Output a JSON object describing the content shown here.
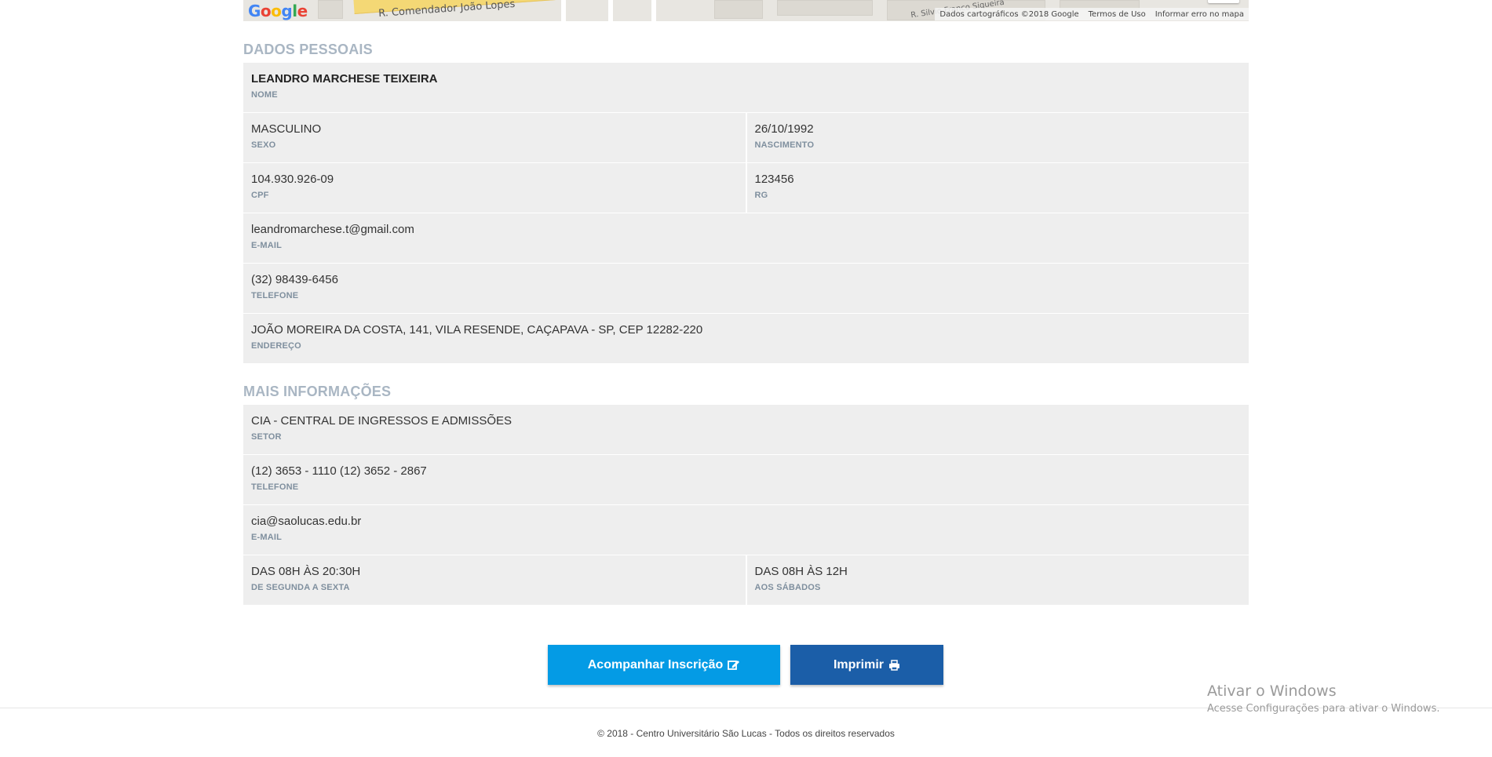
{
  "map": {
    "street_main": "R. Comendador João Lopes",
    "street_secondary": "R. Silvio Franco Siqueira",
    "logo_text": "Google",
    "attribution": {
      "data": "Dados cartográficos ©2018 Google",
      "terms": "Termos de Uso",
      "report": "Informar erro no mapa"
    }
  },
  "dados_pessoais": {
    "title": "DADOS PESSOAIS",
    "nome": {
      "value": "LEANDRO MARCHESE TEIXEIRA",
      "label": "NOME"
    },
    "sexo": {
      "value": "MASCULINO",
      "label": "SEXO"
    },
    "nascimento": {
      "value": "26/10/1992",
      "label": "NASCIMENTO"
    },
    "cpf": {
      "value": "104.930.926-09",
      "label": "CPF"
    },
    "rg": {
      "value": "123456",
      "label": "RG"
    },
    "email": {
      "value": "leandromarchese.t@gmail.com",
      "label": "E-MAIL"
    },
    "telefone": {
      "value": "(32) 98439-6456",
      "label": "TELEFONE"
    },
    "endereco": {
      "value": "JOÃO MOREIRA DA COSTA, 141, VILA RESENDE, CAÇAPAVA - SP, CEP 12282-220",
      "label": "ENDEREÇO"
    }
  },
  "mais_informacoes": {
    "title": "MAIS INFORMAÇÕES",
    "setor": {
      "value": "CIA - CENTRAL DE INGRESSOS E ADMISSÕES",
      "label": "SETOR"
    },
    "telefone": {
      "value": "(12) 3653 - 1110 (12) 3652 - 2867",
      "label": "TELEFONE"
    },
    "email": {
      "value": "cia@saolucas.edu.br",
      "label": "E-MAIL"
    },
    "semana": {
      "value": "DAS 08H ÀS 20:30H",
      "label": "DE SEGUNDA A SEXTA"
    },
    "sabado": {
      "value": "DAS 08H ÀS 12H",
      "label": "AOS SÁBADOS"
    }
  },
  "actions": {
    "acompanhar_label": "Acompanhar Inscrição",
    "acompanhar_icon": "edit-icon",
    "imprimir_label": "Imprimir",
    "imprimir_icon": "print-icon",
    "acompanhar_color": "#049be5",
    "imprimir_color": "#1b5ea8"
  },
  "footer": {
    "copyright": "© 2018 - Centro Universitário São Lucas - Todos os direitos reservados"
  },
  "windows_watermark": {
    "title": "Ativar o Windows",
    "subtitle": "Acesse Configurações para ativar o Windows."
  },
  "colors": {
    "section_title": "#a9b6c3",
    "card_bg": "#eeeeee",
    "label": "#7f8f9e"
  }
}
